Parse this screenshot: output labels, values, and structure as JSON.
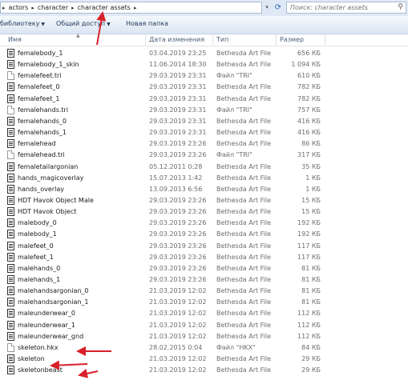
{
  "address_bar": {
    "breadcrumbs": [
      "actors",
      "character",
      "character assets"
    ],
    "search_placeholder": "Поиск: character assets"
  },
  "toolbar": {
    "library_label": "библиотеку",
    "share_label": "Общий доступ",
    "new_folder_label": "Новая папка"
  },
  "columns": {
    "name": "Имя",
    "date": "Дата изменения",
    "type": "Тип",
    "size": "Размер"
  },
  "files": [
    {
      "name": "femalebody_1",
      "date": "03.04.2019 23:25",
      "type": "Bethesda Art File",
      "size": "656 КБ",
      "icon": "art-file-icon"
    },
    {
      "name": "femalebody_1_skin",
      "date": "11.06.2014 18:30",
      "type": "Bethesda Art File",
      "size": "1 094 КБ",
      "icon": "art-file-icon"
    },
    {
      "name": "femalefeet.tri",
      "date": "29.03.2019 23:31",
      "type": "Файл \"TRI\"",
      "size": "610 КБ",
      "icon": "file-icon"
    },
    {
      "name": "femalefeet_0",
      "date": "29.03.2019 23:31",
      "type": "Bethesda Art File",
      "size": "782 КБ",
      "icon": "art-file-icon"
    },
    {
      "name": "femalefeet_1",
      "date": "29.03.2019 23:31",
      "type": "Bethesda Art File",
      "size": "782 КБ",
      "icon": "art-file-icon"
    },
    {
      "name": "femalehands.tri",
      "date": "29.03.2019 23:31",
      "type": "Файл \"TRI\"",
      "size": "757 КБ",
      "icon": "file-icon"
    },
    {
      "name": "femalehands_0",
      "date": "29.03.2019 23:31",
      "type": "Bethesda Art File",
      "size": "416 КБ",
      "icon": "art-file-icon"
    },
    {
      "name": "femalehands_1",
      "date": "29.03.2019 23:31",
      "type": "Bethesda Art File",
      "size": "416 КБ",
      "icon": "art-file-icon"
    },
    {
      "name": "femalehead",
      "date": "29.03.2019 23:26",
      "type": "Bethesda Art File",
      "size": "86 КБ",
      "icon": "art-file-icon"
    },
    {
      "name": "femalehead.tri",
      "date": "29.03.2019 23:26",
      "type": "Файл \"TRI\"",
      "size": "317 КБ",
      "icon": "file-icon"
    },
    {
      "name": "femaletailargonian",
      "date": "05.12.2011 0:28",
      "type": "Bethesda Art File",
      "size": "35 КБ",
      "icon": "art-file-icon"
    },
    {
      "name": "hands_magicoverlay",
      "date": "15.07.2013 1:42",
      "type": "Bethesda Art File",
      "size": "1 КБ",
      "icon": "art-file-icon"
    },
    {
      "name": "hands_overlay",
      "date": "13.09.2013 6:56",
      "type": "Bethesda Art File",
      "size": "1 КБ",
      "icon": "art-file-icon"
    },
    {
      "name": "HDT Havok Object Male",
      "date": "29.03.2019 23:26",
      "type": "Bethesda Art File",
      "size": "15 КБ",
      "icon": "art-file-icon"
    },
    {
      "name": "HDT Havok Object",
      "date": "29.03.2019 23:26",
      "type": "Bethesda Art File",
      "size": "15 КБ",
      "icon": "art-file-icon"
    },
    {
      "name": "malebody_0",
      "date": "29.03.2019 23:26",
      "type": "Bethesda Art File",
      "size": "192 КБ",
      "icon": "art-file-icon"
    },
    {
      "name": "malebody_1",
      "date": "29.03.2019 23:26",
      "type": "Bethesda Art File",
      "size": "192 КБ",
      "icon": "art-file-icon"
    },
    {
      "name": "malefeet_0",
      "date": "29.03.2019 23:26",
      "type": "Bethesda Art File",
      "size": "117 КБ",
      "icon": "art-file-icon"
    },
    {
      "name": "malefeet_1",
      "date": "29.03.2019 23:26",
      "type": "Bethesda Art File",
      "size": "117 КБ",
      "icon": "art-file-icon"
    },
    {
      "name": "malehands_0",
      "date": "29.03.2019 23:26",
      "type": "Bethesda Art File",
      "size": "81 КБ",
      "icon": "art-file-icon"
    },
    {
      "name": "malehands_1",
      "date": "29.03.2019 23:26",
      "type": "Bethesda Art File",
      "size": "81 КБ",
      "icon": "art-file-icon"
    },
    {
      "name": "malehandsargonian_0",
      "date": "21.03.2019 12:02",
      "type": "Bethesda Art File",
      "size": "81 КБ",
      "icon": "art-file-icon"
    },
    {
      "name": "malehandsargonian_1",
      "date": "21.03.2019 12:02",
      "type": "Bethesda Art File",
      "size": "81 КБ",
      "icon": "art-file-icon"
    },
    {
      "name": "maleunderwear_0",
      "date": "21.03.2019 12:02",
      "type": "Bethesda Art File",
      "size": "112 КБ",
      "icon": "art-file-icon"
    },
    {
      "name": "maleunderwear_1",
      "date": "21.03.2019 12:02",
      "type": "Bethesda Art File",
      "size": "112 КБ",
      "icon": "art-file-icon"
    },
    {
      "name": "maleunderwear_gnd",
      "date": "21.03.2019 12:02",
      "type": "Bethesda Art File",
      "size": "112 КБ",
      "icon": "art-file-icon"
    },
    {
      "name": "skeleton.hkx",
      "date": "28.02.2015 0:04",
      "type": "Файл \"HKX\"",
      "size": "84 КБ",
      "icon": "file-icon"
    },
    {
      "name": "skeleton",
      "date": "21.03.2019 12:02",
      "type": "Bethesda Art File",
      "size": "29 КБ",
      "icon": "art-file-icon"
    },
    {
      "name": "skeletonbeast",
      "date": "21.03.2019 12:02",
      "type": "Bethesda Art File",
      "size": "29 КБ",
      "icon": "art-file-icon"
    }
  ],
  "colors": {
    "annotation_arrow": "#d9202a",
    "toolbar_text": "#1e395b",
    "header_text": "#4c607a",
    "secondary_text": "#6d6d6d"
  }
}
